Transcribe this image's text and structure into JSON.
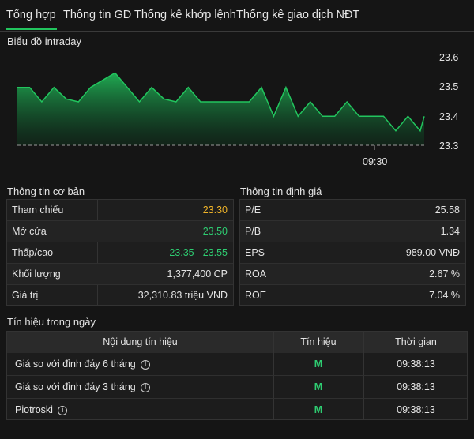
{
  "tabs": [
    {
      "label": "Tổng hợp"
    },
    {
      "label": "Thông tin GD"
    },
    {
      "label": "Thống kê khớp lệnh"
    },
    {
      "label": "Thống kê giao dịch NĐT"
    }
  ],
  "chart": {
    "title": "Biểu đồ intraday",
    "y_ticks": [
      "23.6",
      "23.5",
      "23.4",
      "23.3"
    ],
    "x_ticks": [
      "09:30"
    ],
    "line_color": "#22c55e",
    "reference_line": "dashed grey"
  },
  "chart_data": {
    "type": "area",
    "title": "Biểu đồ intraday",
    "ylim": [
      23.3,
      23.6
    ],
    "reference": 23.3,
    "x_tick_labels": [
      "09:30"
    ],
    "points": [
      [
        0,
        23.5
      ],
      [
        3,
        23.5
      ],
      [
        6,
        23.45
      ],
      [
        9,
        23.5
      ],
      [
        12,
        23.46
      ],
      [
        15,
        23.45
      ],
      [
        18,
        23.5
      ],
      [
        24,
        23.55
      ],
      [
        27,
        23.5
      ],
      [
        30,
        23.45
      ],
      [
        33,
        23.5
      ],
      [
        36,
        23.46
      ],
      [
        39,
        23.45
      ],
      [
        42,
        23.5
      ],
      [
        45,
        23.45
      ],
      [
        48,
        23.45
      ],
      [
        51,
        23.45
      ],
      [
        54,
        23.45
      ],
      [
        57,
        23.45
      ],
      [
        60,
        23.5
      ],
      [
        63,
        23.4
      ],
      [
        66,
        23.5
      ],
      [
        69,
        23.4
      ],
      [
        72,
        23.45
      ],
      [
        75,
        23.4
      ],
      [
        78,
        23.4
      ],
      [
        81,
        23.45
      ],
      [
        84,
        23.4
      ],
      [
        87,
        23.4
      ],
      [
        90,
        23.4
      ],
      [
        93,
        23.35
      ],
      [
        96,
        23.4
      ],
      [
        99,
        23.35
      ],
      [
        100,
        23.4
      ]
    ]
  },
  "basic": {
    "title": "Thông tin cơ bản",
    "rows": [
      {
        "label": "Tham chiếu",
        "value": "23.30",
        "color": "yellow"
      },
      {
        "label": "Mở cửa",
        "value": "23.50",
        "color": "green"
      },
      {
        "label": "Thấp/cao",
        "value": "23.35 - 23.55",
        "color": "green"
      },
      {
        "label": "Khối lượng",
        "value": "1,377,400 CP",
        "color": ""
      },
      {
        "label": "Giá trị",
        "value": "32,310.83 triệu VNĐ",
        "color": ""
      }
    ]
  },
  "valuation": {
    "title": "Thông tin định giá",
    "rows": [
      {
        "label": "P/E",
        "value": "25.58"
      },
      {
        "label": "P/B",
        "value": "1.34"
      },
      {
        "label": "EPS",
        "value": "989.00 VNĐ"
      },
      {
        "label": "ROA",
        "value": "2.67 %"
      },
      {
        "label": "ROE",
        "value": "7.04 %"
      }
    ]
  },
  "signals": {
    "title": "Tín hiệu trong ngày",
    "headers": [
      "Nội dung tín hiệu",
      "Tín hiệu",
      "Thời gian"
    ],
    "rows": [
      {
        "content": "Giá so với đỉnh đáy 6 tháng",
        "signal": "M",
        "time": "09:38:13"
      },
      {
        "content": "Giá so với đỉnh đáy 3 tháng",
        "signal": "M",
        "time": "09:38:13"
      },
      {
        "content": "Piotroski",
        "signal": "M",
        "time": "09:38:13"
      }
    ],
    "info_icon": "info-circle-icon"
  },
  "colors": {
    "background": "#151515",
    "accent_green": "#22c55e",
    "reference_yellow": "#f0b429"
  }
}
